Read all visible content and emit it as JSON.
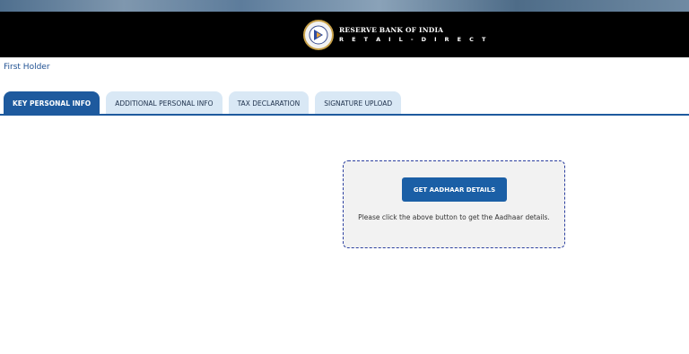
{
  "header": {
    "brand_name": "RESERVE BANK OF INDIA",
    "brand_tagline": "R E T A I L - D I R E C T",
    "logo_icon": "rbi-emblem-icon",
    "background": "#000000"
  },
  "section": {
    "title": "First Holder"
  },
  "tabs": [
    {
      "label": "KEY PERSONAL INFO",
      "active": true
    },
    {
      "label": "ADDITIONAL PERSONAL INFO",
      "active": false
    },
    {
      "label": "TAX DECLARATION",
      "active": false
    },
    {
      "label": "SIGNATURE UPLOAD",
      "active": false
    }
  ],
  "aadhaar": {
    "button_label": "GET AADHAAR DETAILS",
    "help_text": "Please click the above button to get the Aadhaar details."
  },
  "colors": {
    "accent": "#1e5a9e",
    "tab_inactive": "#d9e8f5",
    "card_border": "#2b3fa0"
  }
}
